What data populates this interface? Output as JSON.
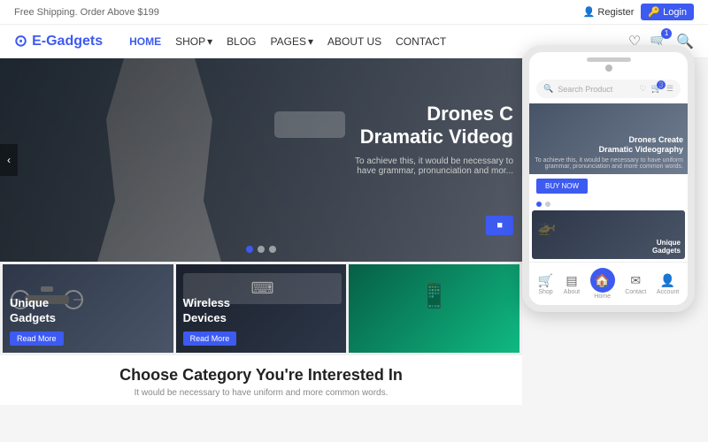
{
  "topbar": {
    "shipping_text": "Free Shipping. Order Above $199",
    "register_label": "Register",
    "login_label": "Login"
  },
  "header": {
    "logo_icon": "⊙",
    "logo_text": "E-Gadgets",
    "nav": [
      {
        "label": "HOME",
        "active": true
      },
      {
        "label": "SHOP",
        "has_dropdown": true
      },
      {
        "label": "BLOG"
      },
      {
        "label": "PAGES",
        "has_dropdown": true
      },
      {
        "label": "ABOUT US"
      },
      {
        "label": "CONTACT"
      }
    ],
    "cart_count": "1",
    "wishlist_count": "0"
  },
  "hero": {
    "title_line1": "Drones C",
    "title_line2": "Dramatic Videog",
    "subtitle": "To achieve this, it would be necessary to have grammar, pronunciation and mor...",
    "dots": [
      {
        "active": true
      },
      {
        "active": false
      },
      {
        "active": false
      }
    ]
  },
  "product_cards": [
    {
      "title": "Unique\nGadgets",
      "btn_label": "Read More"
    },
    {
      "title": "Wireless\nDevices",
      "btn_label": "Read More"
    },
    {
      "title": "",
      "btn_label": ""
    }
  ],
  "category": {
    "title": "Choose Category You're Interested In",
    "subtitle": "It would be necessary to have uniform and more common words."
  },
  "mobile": {
    "search_placeholder": "Search Product",
    "cart_badge": "3",
    "hero_title_line1": "Drones Create",
    "hero_title_line2": "Dramatic Videography",
    "hero_subtitle": "To achieve this, it would be necessary to have uniform grammar, pronunciation and more common words.",
    "buy_btn": "BUY NOW",
    "card_title": "Unique\nGadgets",
    "nav_items": [
      {
        "label": "Shop",
        "icon": "🛒"
      },
      {
        "label": "About",
        "icon": "ℹ"
      },
      {
        "label": "Home",
        "icon": "🏠",
        "active": true
      },
      {
        "label": "Contact",
        "icon": "✉"
      },
      {
        "label": "Account",
        "icon": "👤"
      }
    ]
  }
}
